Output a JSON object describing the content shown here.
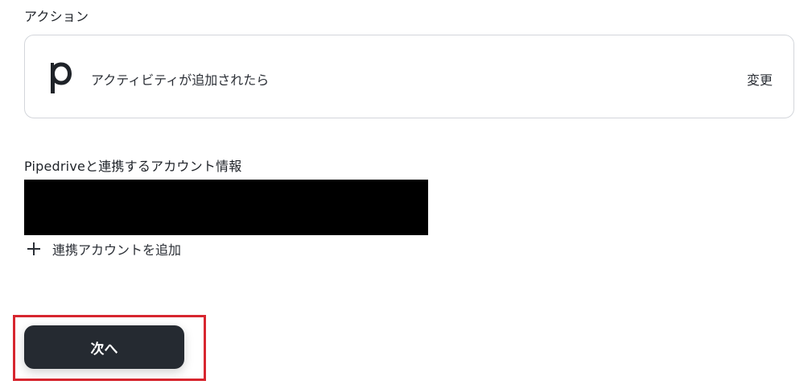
{
  "action_section": {
    "label": "アクション",
    "card": {
      "app_icon": "pipedrive-p-icon",
      "title": "アクティビティが追加されたら",
      "change_label": "変更"
    }
  },
  "account_section": {
    "label": "Pipedriveと連携するアカウント情報",
    "add_account_label": "連携アカウントを追加",
    "add_icon": "plus-icon"
  },
  "footer": {
    "next_label": "次へ"
  },
  "colors": {
    "button_bg": "#252a31",
    "highlight": "#d7262f",
    "card_border": "#d3d6db"
  }
}
